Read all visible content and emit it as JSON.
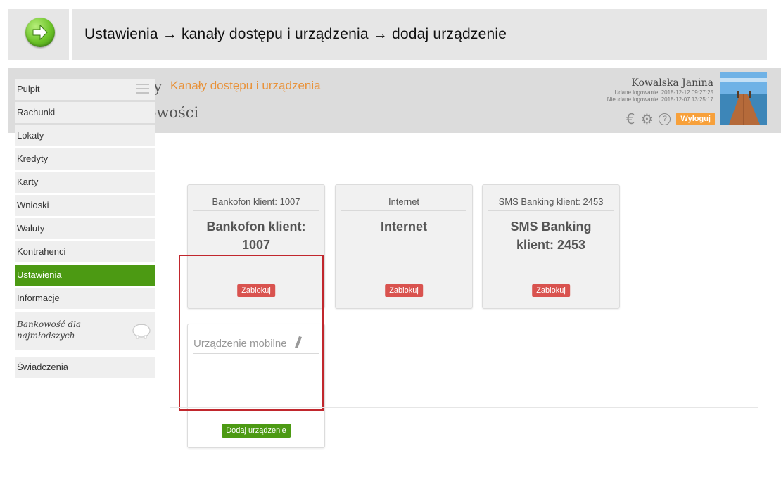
{
  "instruction": {
    "breadcrumb": "Ustawienia → kanały dostępu i urządzenia → dodaj urządzenie",
    "icon": "green-arrow-right-icon"
  },
  "header": {
    "bank_name_line1": "Bank Spółdzielczy",
    "bank_name_line2": "w Naszej Miejscowości",
    "user_name": "Kowalska Janina",
    "login_success": "Udane logowanie: 2018-12-12 09:27:25",
    "login_failed": "Nieudane logowanie: 2018-12-07 13:25:17",
    "currency_icon": "€",
    "settings_icon": "⚙",
    "help_icon": "?",
    "logout_label": "Wyloguj"
  },
  "sidebar": {
    "items": [
      {
        "label": "Pulpit"
      },
      {
        "label": "Rachunki"
      },
      {
        "label": "Lokaty"
      },
      {
        "label": "Kredyty"
      },
      {
        "label": "Karty"
      },
      {
        "label": "Wnioski"
      },
      {
        "label": "Waluty"
      },
      {
        "label": "Kontrahenci"
      },
      {
        "label": "Ustawienia",
        "active": true
      },
      {
        "label": "Informacje"
      }
    ],
    "special": {
      "line1": "Bankowość dla",
      "line2": "najmłodszych"
    },
    "benefits": "Świadczenia"
  },
  "main": {
    "title": "Kanały dostępu i urządzenia",
    "cards": [
      {
        "small": "Bankofon klient: 1007",
        "big_line1": "Bankofon klient:",
        "big_line2": "1007",
        "button": "Zablokuj"
      },
      {
        "small": "Internet",
        "big_line1": "Internet",
        "big_line2": "",
        "button": "Zablokuj"
      },
      {
        "small": "SMS Banking klient: 2453",
        "big_line1": "SMS Banking",
        "big_line2": "klient: 2453",
        "button": "Zablokuj"
      }
    ],
    "mobile_card": {
      "title": "Urządzenie mobilne",
      "button": "Dodaj urządzenie"
    }
  },
  "colors": {
    "accent_green": "#4c9a13",
    "title_orange": "#e8923a",
    "logout_orange": "#f7a03a",
    "block_red": "#d9534f",
    "highlight_red": "#c1272d"
  }
}
